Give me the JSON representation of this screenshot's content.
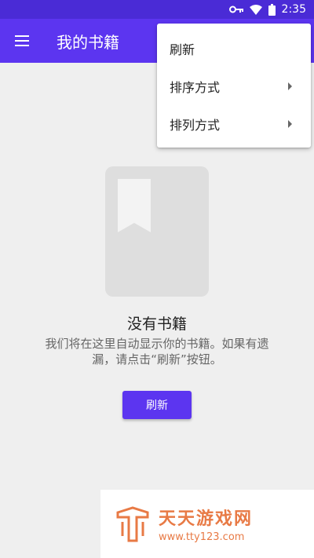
{
  "status_bar": {
    "time": "2:35",
    "icons": [
      "key-icon",
      "wifi-icon",
      "battery-icon"
    ]
  },
  "app_bar": {
    "title": "我的书籍",
    "menu_icon": "hamburger-icon"
  },
  "overflow_menu": {
    "items": [
      {
        "label": "刷新",
        "has_submenu": false
      },
      {
        "label": "排序方式",
        "has_submenu": true
      },
      {
        "label": "排列方式",
        "has_submenu": true
      }
    ]
  },
  "empty_state": {
    "icon": "book-bookmark-icon",
    "title": "没有书籍",
    "description": "我们将在这里自动显示你的书籍。如果有遗漏，请点击“刷新”按钮。",
    "button_label": "刷新"
  },
  "watermark": {
    "name": "天天游戏网",
    "url": "www.tty123.com"
  },
  "colors": {
    "primary": "#5c35f0",
    "status_bar": "#4a2bd6",
    "background": "#efefef",
    "accent_watermark": "#e87a45"
  }
}
